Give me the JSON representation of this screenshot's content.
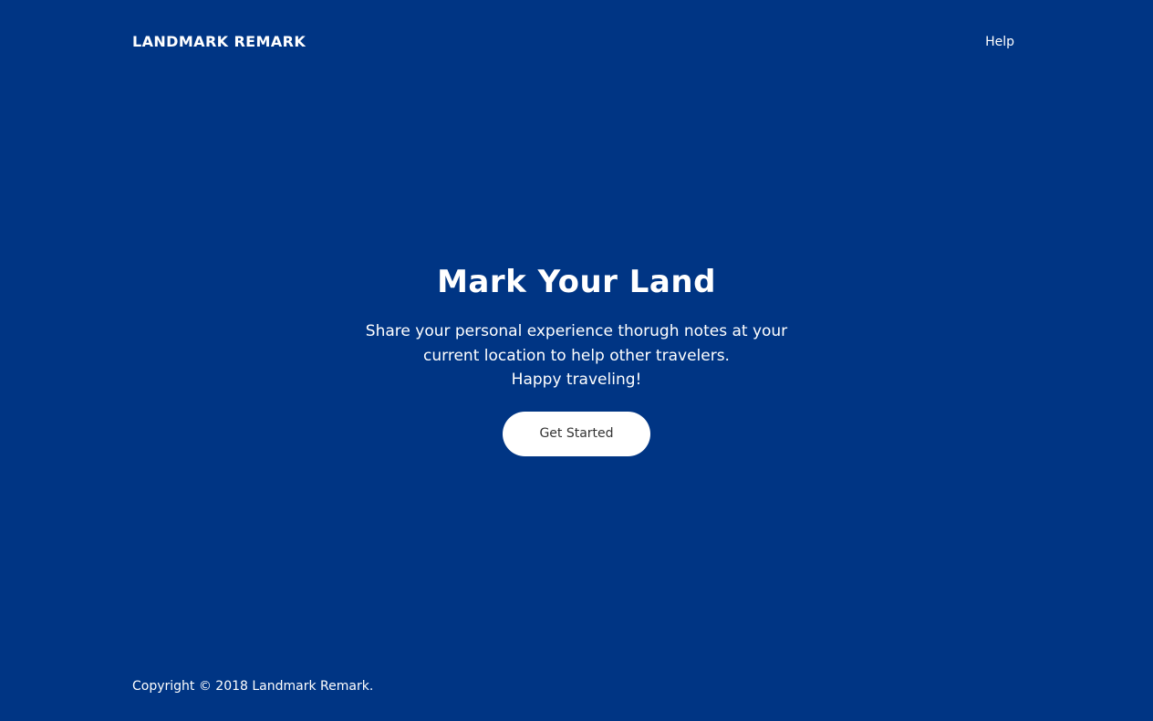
{
  "header": {
    "brand": "LANDMARK REMARK",
    "help_label": "Help"
  },
  "hero": {
    "title": "Mark Your Land",
    "description_lines": [
      "Share your personal experience thorugh notes at your",
      "current location to help other travelers.",
      "Happy traveling!"
    ],
    "cta_label": "Get Started"
  },
  "footer": {
    "copyright": "Copyright © 2018 Landmark Remark."
  },
  "colors": {
    "background": "#003584",
    "text": "#ffffff",
    "button_background": "#ffffff",
    "button_text": "#333333"
  }
}
